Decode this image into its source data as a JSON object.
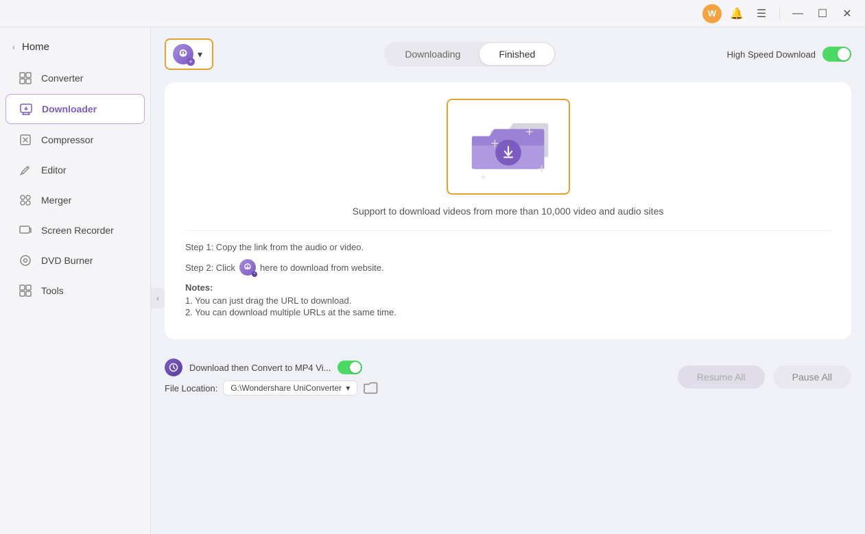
{
  "titlebar": {
    "user_icon_label": "W",
    "user_icon_color": "#f4a340",
    "bell_icon": "🔔",
    "menu_icon": "☰",
    "min_icon": "—",
    "max_icon": "☐",
    "close_icon": "✕"
  },
  "sidebar": {
    "back_label": "Home",
    "items": [
      {
        "id": "converter",
        "label": "Converter",
        "icon": "⊞"
      },
      {
        "id": "downloader",
        "label": "Downloader",
        "icon": "⬇",
        "active": true
      },
      {
        "id": "compressor",
        "label": "Compressor",
        "icon": "⊡"
      },
      {
        "id": "editor",
        "label": "Editor",
        "icon": "✂"
      },
      {
        "id": "merger",
        "label": "Merger",
        "icon": "⊞"
      },
      {
        "id": "screen-recorder",
        "label": "Screen Recorder",
        "icon": "⊙"
      },
      {
        "id": "dvd-burner",
        "label": "DVD Burner",
        "icon": "⊙"
      },
      {
        "id": "tools",
        "label": "Tools",
        "icon": "⊞"
      }
    ]
  },
  "topbar": {
    "add_url_label": "▾",
    "tabs": [
      {
        "id": "downloading",
        "label": "Downloading",
        "active": false
      },
      {
        "id": "finished",
        "label": "Finished",
        "active": true
      }
    ],
    "high_speed_label": "High Speed Download"
  },
  "dropzone": {
    "description": "Support to download videos from more than 10,000 video and audio sites",
    "step1": "Step 1: Copy the link from the audio or video.",
    "step2_prefix": "Step 2: Click",
    "step2_suffix": "here to download from website.",
    "notes_title": "Notes:",
    "note1": "1. You can just drag the URL to download.",
    "note2": "2. You can download multiple URLs at the same time."
  },
  "bottom_bar": {
    "convert_label": "Download then Convert to MP4 Vi...",
    "file_location_label": "File Location:",
    "file_location_value": "G:\\Wondershare UniConverter ▾",
    "resume_label": "Resume All",
    "pause_label": "Pause All"
  }
}
